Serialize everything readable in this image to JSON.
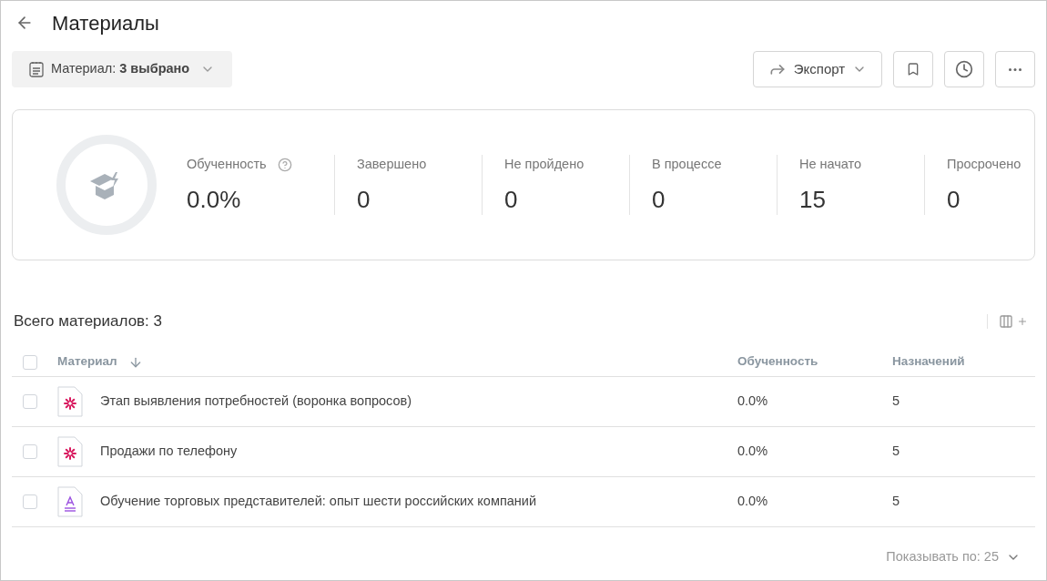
{
  "header": {
    "title": "Материалы"
  },
  "filter": {
    "label": "Материал: **3 выбрано**"
  },
  "toolbar": {
    "export_label": "Экспорт"
  },
  "summary": {
    "ring": {
      "level": 0
    },
    "stats": [
      {
        "label": "Обученность",
        "value": "0.0%",
        "help": true
      },
      {
        "label": "Завершено",
        "value": "0",
        "help": false
      },
      {
        "label": "Не пройдено",
        "value": "0",
        "help": false
      },
      {
        "label": "В процессе",
        "value": "0",
        "help": false
      },
      {
        "label": "Не начато",
        "value": "15",
        "help": false
      },
      {
        "label": "Просрочено",
        "value": "0",
        "help": false
      }
    ]
  },
  "table": {
    "total": "Всего материалов: 3",
    "select_all": {
      "checked": false
    },
    "columns": [
      "Материал",
      "Обученность",
      "Назначений"
    ],
    "rows": [
      {
        "kind": "burst",
        "checked": false,
        "name": "Этап выявления потребностей (воронка вопросов)",
        "progress": "0.0%",
        "assignments": "5"
      },
      {
        "kind": "burst",
        "checked": false,
        "name": "Продажи по телефону",
        "progress": "0.0%",
        "assignments": "5"
      },
      {
        "kind": "text",
        "checked": false,
        "name": "Обучение торговых представителей: опыт шести российских компаний",
        "progress": "0.0%",
        "assignments": "5"
      }
    ]
  },
  "pagination": {
    "label": "Показывать по: 25"
  }
}
